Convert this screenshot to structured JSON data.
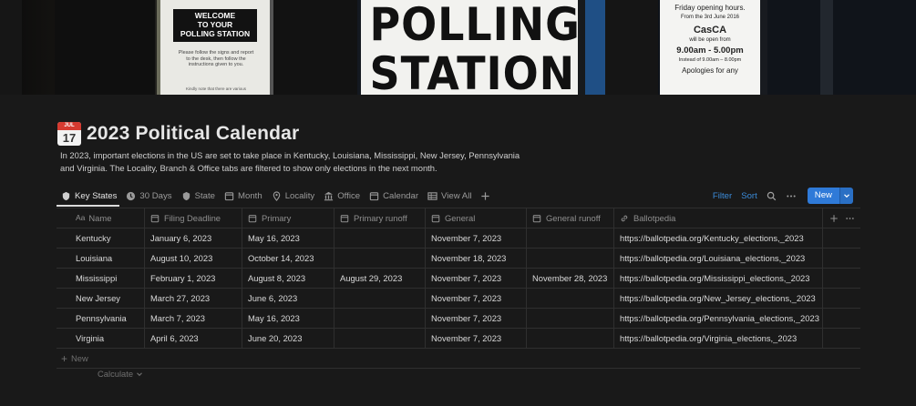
{
  "cover": {
    "sign_left": [
      "WELCOME",
      "TO YOUR",
      "POLLING STATION"
    ],
    "sign_left_small": "Please follow the signs and report to the desk, then follow the instructions given to you.",
    "sign_left_tiny": "Kindly note that there are various",
    "sign_center": [
      "POLLING",
      "STATION"
    ],
    "sign_right": {
      "line1": "Friday opening hours.",
      "line2": "From the 3rd June 2016",
      "brand": "CasCA",
      "line3": "will be open from",
      "hours": "9.00am - 5.00pm",
      "line4": "Instead of 9.00am – 8.00pm",
      "line5": "Apologies for any"
    }
  },
  "page": {
    "icon": {
      "month": "JUL",
      "day": "17"
    },
    "title": "2023 Political Calendar",
    "description": "In 2023, important elections in the US are set to take place in Kentucky, Louisiana, Mississippi, New Jersey, Pennsylvania and Virginia. The Locality, Branch & Office tabs are filtered to show only elections in the next month."
  },
  "tabs": [
    {
      "label": "Key States"
    },
    {
      "label": "30 Days"
    },
    {
      "label": "State"
    },
    {
      "label": "Month"
    },
    {
      "label": "Locality"
    },
    {
      "label": "Office"
    },
    {
      "label": "Calendar"
    },
    {
      "label": "View All"
    }
  ],
  "toolbar": {
    "filter": "Filter",
    "sort": "Sort",
    "new": "New"
  },
  "table": {
    "columns": [
      "Name",
      "Filing Deadline",
      "Primary",
      "Primary runoff",
      "General",
      "General runoff",
      "Ballotpedia"
    ],
    "rows": [
      [
        "Kentucky",
        "January 6, 2023",
        "May 16, 2023",
        "",
        "November 7, 2023",
        "",
        "https://ballotpedia.org/Kentucky_elections,_2023"
      ],
      [
        "Louisiana",
        "August 10, 2023",
        "October 14, 2023",
        "",
        "November 18, 2023",
        "",
        "https://ballotpedia.org/Louisiana_elections,_2023"
      ],
      [
        "Mississippi",
        "February 1, 2023",
        "August 8, 2023",
        "August 29, 2023",
        "November 7, 2023",
        "November 28, 2023",
        "https://ballotpedia.org/Mississippi_elections,_2023"
      ],
      [
        "New Jersey",
        "March 27, 2023",
        "June 6, 2023",
        "",
        "November 7, 2023",
        "",
        "https://ballotpedia.org/New_Jersey_elections,_2023"
      ],
      [
        "Pennsylvania",
        "March 7, 2023",
        "May 16, 2023",
        "",
        "November 7, 2023",
        "",
        "https://ballotpedia.org/Pennsylvania_elections,_2023"
      ],
      [
        "Virginia",
        "April 6, 2023",
        "June 20, 2023",
        "",
        "November 7, 2023",
        "",
        "https://ballotpedia.org/Virginia_elections,_2023"
      ]
    ],
    "new_row": "New",
    "calculate": "Calculate"
  }
}
